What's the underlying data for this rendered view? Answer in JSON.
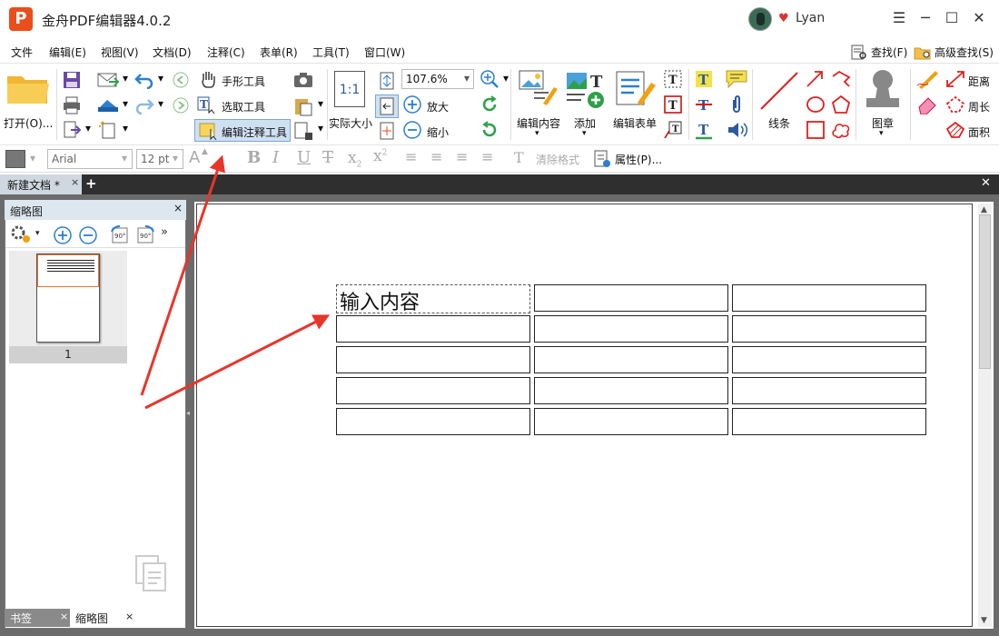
{
  "app": {
    "logo_letter": "P",
    "title": "金舟PDF编辑器4.0.2",
    "user": "Lyan"
  },
  "window": {
    "minimize": "─",
    "maximize": "☐",
    "close": "✕",
    "hamburger": "☰"
  },
  "menu": [
    "文件",
    "编辑(E)",
    "视图(V)",
    "文档(D)",
    "注释(C)",
    "表单(R)",
    "工具(T)",
    "窗口(W)"
  ],
  "menu_right": {
    "find": "查找(F)",
    "advanced_find": "高级查找(S)"
  },
  "ribbon": {
    "open": "打开(O)...",
    "hand_tool": "手形工具",
    "select_tool": "选取工具",
    "edit_annotation_tool": "编辑注释工具",
    "actual_size": "实际大小",
    "zoom_value": "107.6%",
    "zoom_in": "放大",
    "zoom_out": "缩小",
    "edit_content": "编辑内容",
    "add": "添加",
    "edit_form": "编辑表单",
    "line": "线条",
    "stamp": "图章",
    "distance": "距离",
    "perimeter": "周长",
    "area": "面积",
    "actual_size_icon_text": "1:1"
  },
  "format": {
    "font": "Arial",
    "size": "12 pt",
    "clear_format": "清除格式",
    "properties": "属性(P)..."
  },
  "tabs": {
    "doc_tab": "新建文档 *",
    "close": "×",
    "add": "+",
    "close_all": "✕"
  },
  "panel": {
    "title": "缩略图",
    "close": "×",
    "page_number": "1",
    "bottom_tabs": [
      {
        "label": "书签"
      },
      {
        "label": "缩略图"
      }
    ]
  },
  "document": {
    "first_cell_text": "输入内容",
    "rows": 5,
    "cols": 3
  },
  "colors": {
    "accent": "#e94e1b",
    "tab_dark": "#2f2f2f",
    "viewer_bg": "#6b6b6b",
    "arrow": "#e8352a"
  }
}
